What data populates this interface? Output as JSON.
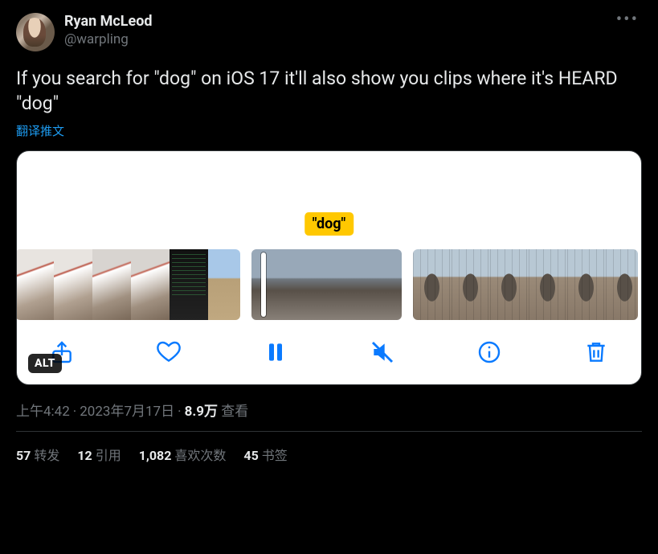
{
  "author": {
    "display_name": "Ryan McLeod",
    "username": "@warpling"
  },
  "tweet_text": "If you search for \"dog\" on iOS 17 it'll also show you clips where it's HEARD \"dog\"",
  "translate_label": "翻译推文",
  "media": {
    "search_tag": "\"dog\"",
    "alt_badge": "ALT"
  },
  "meta": {
    "time": "上午4:42",
    "date": "2023年7月17日",
    "views_count": "8.9万",
    "views_label": "查看"
  },
  "stats": {
    "retweets": {
      "count": "57",
      "label": "转发"
    },
    "quotes": {
      "count": "12",
      "label": "引用"
    },
    "likes": {
      "count": "1,082",
      "label": "喜欢次数"
    },
    "bookmarks": {
      "count": "45",
      "label": "书签"
    }
  }
}
